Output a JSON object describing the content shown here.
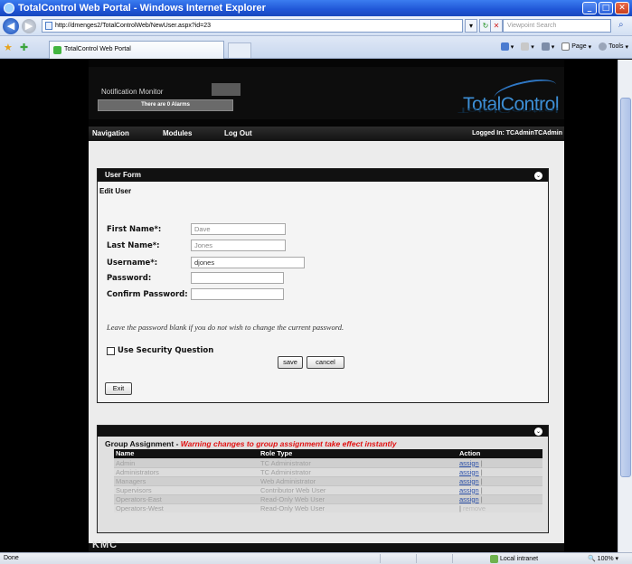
{
  "window": {
    "title": "TotalControl Web Portal - Windows Internet Explorer",
    "controls": [
      "min",
      "max",
      "close"
    ]
  },
  "address_bar": {
    "url": "http://dmenges2/TotalControlWeb/NewUser.aspx?id=23",
    "search_placeholder": "Viewpoint Search",
    "refresh_symbol": "↻",
    "stop_symbol": "✕"
  },
  "tabs": {
    "active_label": "TotalControl Web Portal",
    "tools": {
      "page": "Page",
      "tools": "Tools"
    }
  },
  "portal": {
    "notification_title": "Notification Monitor",
    "alarm_text": "There are 0  Alarms",
    "logo": "TotalControl",
    "nav": {
      "navigation": "Navigation",
      "modules": "Modules",
      "logout": "Log Out",
      "logged_in": "Logged In: TCAdminTCAdmin"
    }
  },
  "user_form": {
    "panel_title": "User Form",
    "section_title": "Edit User",
    "labels": {
      "first_name": "First Name*:",
      "last_name": "Last Name*:",
      "username": "Username*:",
      "password": "Password:",
      "confirm_password": "Confirm Password:"
    },
    "values": {
      "first_name": "Dave",
      "last_name": "Jones",
      "username": "djones",
      "password": "",
      "confirm_password": ""
    },
    "hint": "Leave the password blank if you do not wish to change the current password.",
    "security_question_label": "Use Security Question",
    "save_label": "save",
    "cancel_label": "cancel",
    "exit_label": "Exit"
  },
  "group_assignment": {
    "title": "Group Assignment",
    "separator": " - ",
    "warning": "Warning changes to group assignment take effect instantly",
    "columns": [
      "Name",
      "Role Type",
      "Action"
    ],
    "rows": [
      {
        "name": "Admin",
        "role": "TC Administrator",
        "action": "assign",
        "sep": "|"
      },
      {
        "name": "Administrators",
        "role": "TC Administrator",
        "action": "assign",
        "sep": "|"
      },
      {
        "name": "Managers",
        "role": "Web Administrator",
        "action": "assign",
        "sep": "|"
      },
      {
        "name": "Supervisors",
        "role": "Contributor Web User",
        "action": "assign",
        "sep": "|"
      },
      {
        "name": "Operators-East",
        "role": "Read-Only Web User",
        "action": "assign",
        "sep": "|"
      },
      {
        "name": "Operators-West",
        "role": "Read-Only Web User",
        "action": "remove",
        "sep": "|"
      }
    ]
  },
  "footer": {
    "brand": "KMC"
  },
  "status_bar": {
    "status": "Done",
    "zone": "Local intranet",
    "zoom": "100%"
  },
  "colors": {
    "titlebar": "#1f55d6",
    "logo": "#3d8fd6",
    "warning": "#e01010",
    "link": "#2a4fa8"
  }
}
